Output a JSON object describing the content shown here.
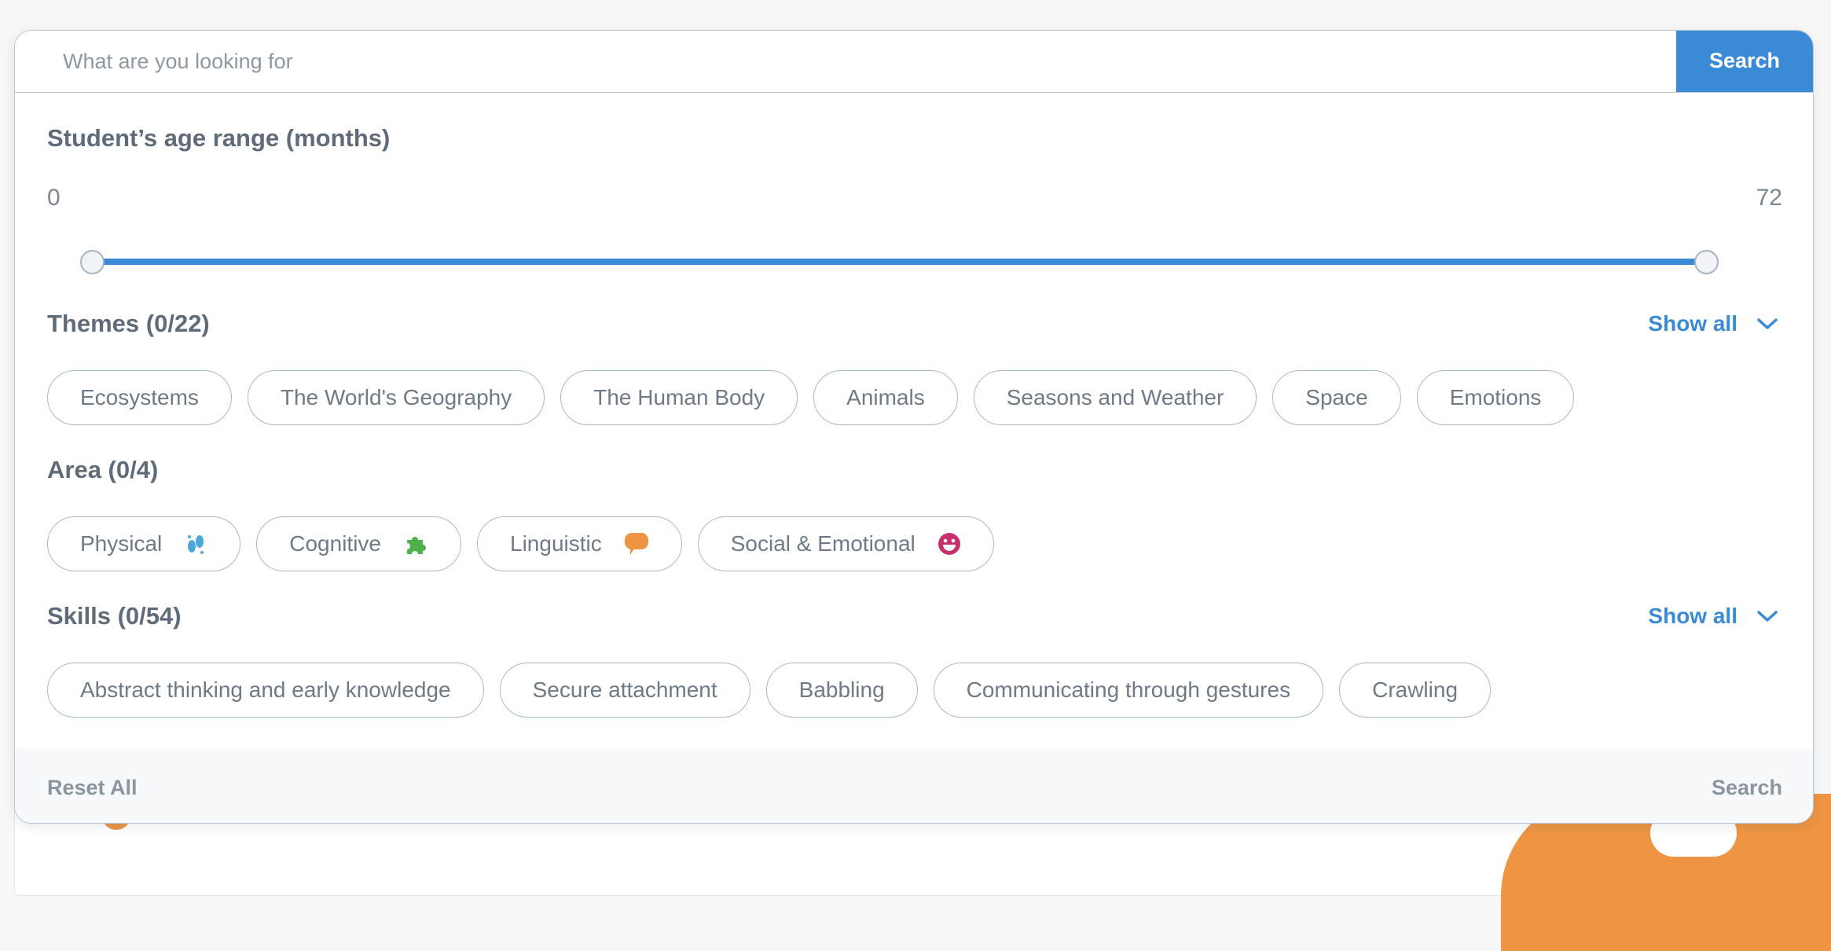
{
  "search": {
    "placeholder": "What are you looking for",
    "button_label": "Search"
  },
  "age_range": {
    "title": "Student’s age range (months)",
    "min_label": "0",
    "max_label": "72",
    "selected_min": 0,
    "selected_max": 72
  },
  "themes": {
    "title": "Themes (0/22)",
    "show_all_label": "Show all",
    "items": [
      "Ecosystems",
      "The World's Geography",
      "The Human Body",
      "Animals",
      "Seasons and Weather",
      "Space",
      "Emotions"
    ]
  },
  "area": {
    "title": "Area (0/4)",
    "items": [
      {
        "label": "Physical",
        "icon": "footprints-icon",
        "color": "#4aa8dc"
      },
      {
        "label": "Cognitive",
        "icon": "puzzle-icon",
        "color": "#4fb14c"
      },
      {
        "label": "Linguistic",
        "icon": "speech-bubble-icon",
        "color": "#ee9443"
      },
      {
        "label": "Social & Emotional",
        "icon": "smiley-icon",
        "color": "#c8306b"
      }
    ]
  },
  "skills": {
    "title": "Skills (0/54)",
    "show_all_label": "Show all",
    "items": [
      "Abstract thinking and early knowledge",
      "Secure attachment",
      "Babbling",
      "Communicating through gestures",
      "Crawling"
    ]
  },
  "footer": {
    "reset_label": "Reset All",
    "search_label": "Search"
  },
  "colors": {
    "accent": "#3a8ad6",
    "chip_border": "#a8b9cc",
    "text": "#6a7683"
  }
}
